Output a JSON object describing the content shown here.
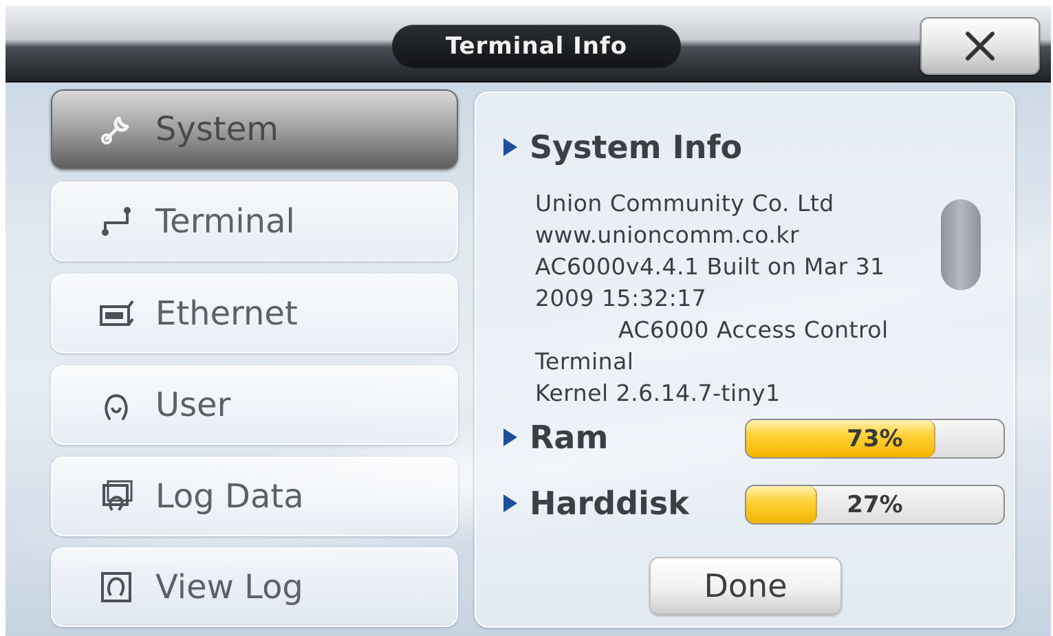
{
  "window": {
    "title": "Terminal Info"
  },
  "menu": {
    "items": [
      {
        "label": "System",
        "icon": "wrench-icon",
        "active": true
      },
      {
        "label": "Terminal",
        "icon": "connector-icon",
        "active": false
      },
      {
        "label": "Ethernet",
        "icon": "network-card-icon",
        "active": false
      },
      {
        "label": "User",
        "icon": "user-icon",
        "active": false
      },
      {
        "label": "Log Data",
        "icon": "log-data-icon",
        "active": false
      },
      {
        "label": "View Log",
        "icon": "view-log-icon",
        "active": false
      }
    ]
  },
  "system_info": {
    "heading": "System Info",
    "lines": [
      "Union Community Co. Ltd",
      "www.unioncomm.co.kr",
      "AC6000v4.4.1 Built on Mar 31",
      "2009 15:32:17",
      "           AC6000 Access Control",
      "Terminal",
      "Kernel 2.6.14.7-tiny1"
    ]
  },
  "ram": {
    "label": "Ram",
    "percent_text": "73%",
    "fraction": 0.73
  },
  "harddisk": {
    "label": "Harddisk",
    "percent_text": "27%",
    "fraction": 0.27
  },
  "done_label": "Done",
  "colors": {
    "accent_triangle": "#1f4f9c",
    "bar_fill": "#ffd33a"
  }
}
